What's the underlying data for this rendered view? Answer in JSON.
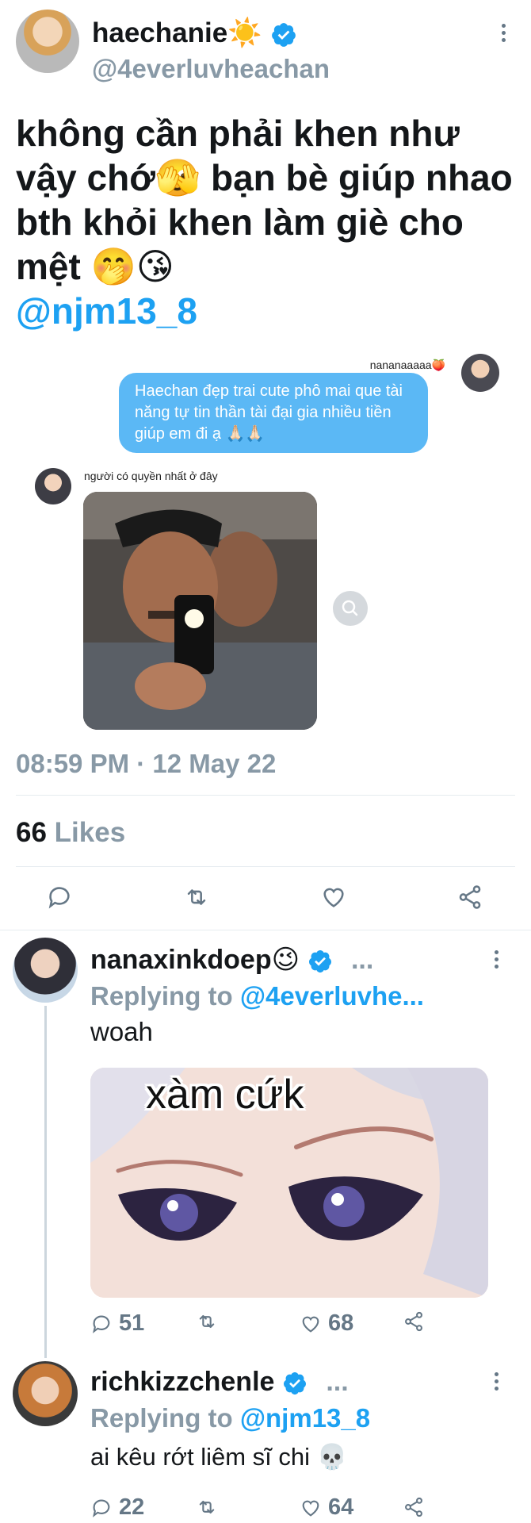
{
  "tweet": {
    "display_name": "haechanie",
    "name_emoji": "☀️",
    "handle": "@4everluvheachan",
    "text": "không cần phải khen như vậy chớ🫣 bạn bè giúp nhao bth khỏi khen làm giè cho mệt 🤭😘",
    "mention": "@njm13_8",
    "timestamp": "08:59 PM · 12 May 22",
    "likes_count": "66",
    "likes_label": "Likes"
  },
  "embedded_chat": {
    "sender_name": "nananaaaaa🍑",
    "bubble_text": "Haechan đẹp trai cute phô mai que tài năng tự tin thần tài đại gia nhiều tiền giúp em đi ạ 🙏🏻🙏🏻",
    "reply_name": "người có quyền nhất ở đây"
  },
  "replies": [
    {
      "display_name": "nanaxinkdoep😉",
      "more": "...",
      "replying_prefix": "Replying to",
      "replying_to": "@4everluvhe...",
      "text": "woah",
      "image_caption": "xàm cứk",
      "reply_count": "51",
      "like_count": "68"
    },
    {
      "display_name": "richkizzchenle",
      "more": "...",
      "replying_prefix": "Replying to",
      "replying_to": "@njm13_8",
      "text": "ai kêu rớt liêm sĩ chi 💀",
      "reply_count": "22",
      "like_count": "64"
    }
  ],
  "colors": {
    "accent": "#1da1f2",
    "bubble": "#5bb8f5",
    "muted": "#8899a6",
    "divider": "#e6ecf0"
  }
}
